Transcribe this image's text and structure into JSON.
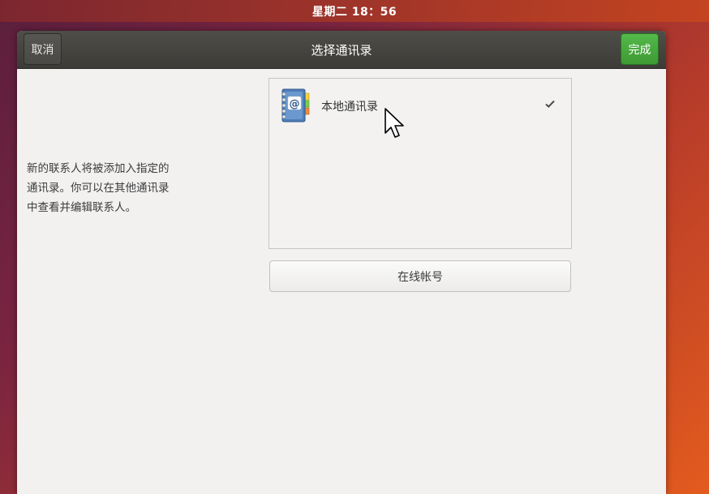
{
  "topbar": {
    "clock": "星期二 18：56"
  },
  "dialog": {
    "title": "选择通讯录",
    "cancel_label": "取消",
    "done_label": "完成",
    "description_lines": [
      "新的联系人将被添加入指定的",
      "通讯录。你可以在其他通讯录",
      "中查看并编辑联系人。"
    ],
    "address_books": [
      {
        "label": "本地通讯录",
        "icon": "address-book-icon",
        "selected": true
      }
    ],
    "online_accounts_label": "在线帐号"
  },
  "colors": {
    "done_button": "#3c9a32",
    "headerbar": "#3c3b37",
    "dialog_bg": "#f2f1f0"
  }
}
